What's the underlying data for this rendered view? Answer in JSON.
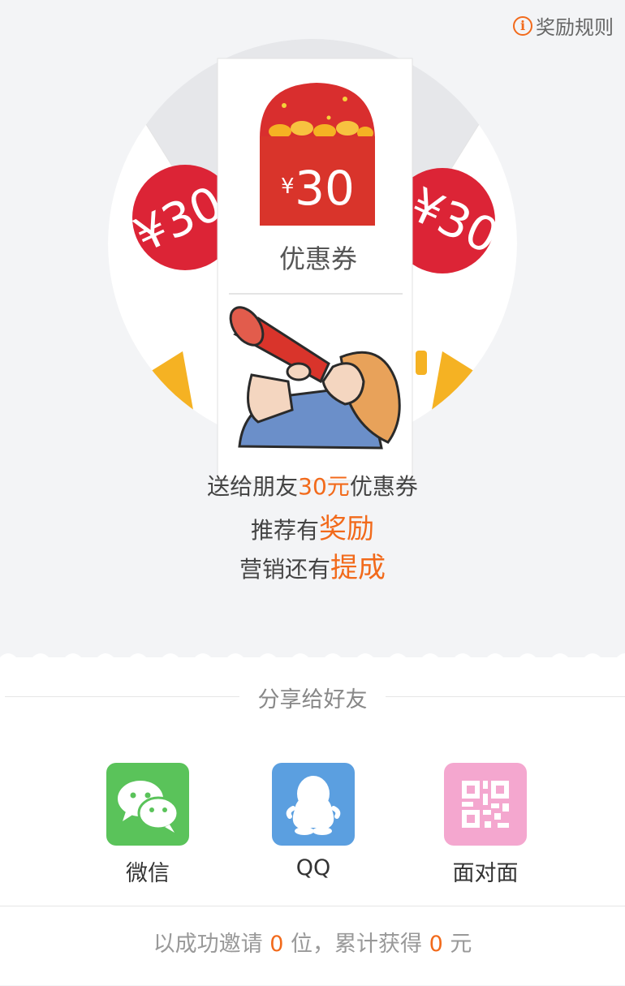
{
  "header": {
    "rules_label": "奖励规则"
  },
  "coupon": {
    "currency_symbol": "¥",
    "amount": "30",
    "side_left": "¥30",
    "side_right": "¥30",
    "label": "优惠券"
  },
  "slogan": {
    "line1_prefix": "送给朋友",
    "line1_highlight": "30元",
    "line1_suffix": "优惠券",
    "line2_prefix": "推荐有",
    "line2_highlight": "奖励",
    "line3_prefix": "营销还有",
    "line3_highlight": "提成"
  },
  "share": {
    "title": "分享给好友",
    "options": [
      {
        "label": "微信",
        "icon": "wechat-icon",
        "color": "#5ac35a"
      },
      {
        "label": "QQ",
        "icon": "qq-penguin-icon",
        "color": "#5b9fe0"
      },
      {
        "label": "面对面",
        "icon": "qrcode-icon",
        "color": "#f4a7cf"
      }
    ]
  },
  "footer": {
    "prefix": "以成功邀请",
    "invited_count": "0",
    "middle": "位，累计获得",
    "earned_amount": "0",
    "suffix": "元"
  },
  "colors": {
    "accent": "#f26a1b",
    "red": "#d92e2e",
    "gold": "#f5b223"
  }
}
